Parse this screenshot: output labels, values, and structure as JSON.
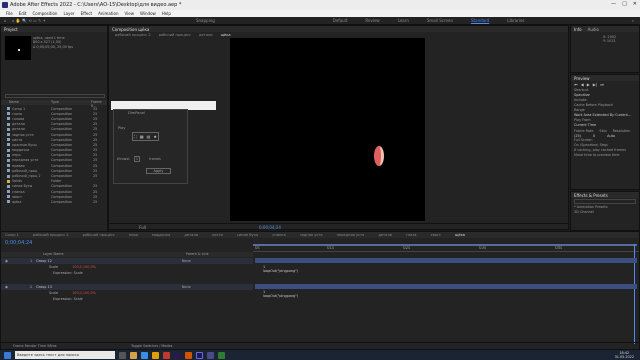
{
  "window": {
    "title": "Adobe After Effects 2022 - C:\\Users\\АО-15\\Desktop\\для видео.aep *"
  },
  "menu": [
    "File",
    "Edit",
    "Composition",
    "Layer",
    "Effect",
    "Animation",
    "View",
    "Window",
    "Help"
  ],
  "toolbar": {
    "snapping": "Snapping",
    "workspaces": [
      "Default",
      "Review",
      "Learn",
      "Small Screen",
      "Standard",
      "Libraries"
    ],
    "active_ws": "Standard"
  },
  "project": {
    "title": "Project",
    "name": "щёка",
    "used": "used 1 time",
    "info1": "800 x 527 (1,00)",
    "info2": "Δ 0;00;05;00, 25,00 fps",
    "items": [
      {
        "n": "Comp 1",
        "t": "Composition",
        "s": "25"
      },
      {
        "n": "глаза",
        "t": "Composition",
        "s": "25"
      },
      {
        "n": "голова",
        "t": "Composition",
        "s": "25"
      },
      {
        "n": "детали",
        "t": "Composition",
        "s": "25"
      },
      {
        "n": "детали",
        "t": "Composition",
        "s": "25"
      },
      {
        "n": "задняя уста",
        "t": "Composition",
        "s": "25"
      },
      {
        "n": "кисти",
        "t": "Composition",
        "s": "25"
      },
      {
        "n": "красные бусы",
        "t": "Composition",
        "s": "25"
      },
      {
        "n": "мордочка",
        "t": "Composition",
        "s": "25"
      },
      {
        "n": "перо",
        "t": "Composition",
        "s": "25"
      },
      {
        "n": "передняя уста",
        "t": "Composition",
        "s": "25"
      },
      {
        "n": "правая",
        "t": "Composition",
        "s": "25"
      },
      {
        "n": "рабочий_проц",
        "t": "Composition",
        "s": "25"
      },
      {
        "n": "рабочий_проц 2",
        "t": "Composition",
        "s": "25"
      },
      {
        "n": "Solids",
        "t": "Folder",
        "s": ""
      },
      {
        "n": "синие бусы",
        "t": "Composition",
        "s": "25"
      },
      {
        "n": "спинка",
        "t": "Composition",
        "s": "25"
      },
      {
        "n": "хвост",
        "t": "Composition",
        "s": "25"
      },
      {
        "n": "щёка",
        "t": "Composition",
        "s": "25"
      }
    ]
  },
  "comp": {
    "title": "Composition щёка",
    "breadcrumbs": [
      "рабочий процесс 2",
      "рабочий процесс",
      "детали",
      "щёка"
    ],
    "zoom": "Full",
    "timecode": "0;00;04;24"
  },
  "dialog": {
    "title": "DimPanel",
    "label": "Play",
    "field_label": "Итоwsl:",
    "value": "1",
    "unit": "frames",
    "apply": "Apply"
  },
  "info": {
    "tabs": [
      "Info",
      "Audio"
    ],
    "x": "X: 2052",
    "y": "Y: 1013"
  },
  "preview": {
    "title": "Preview",
    "shortcut_label": "Shortcut",
    "shortcut": "Spacebar",
    "include": "Include:",
    "cache": "Cache Before Playback",
    "range_label": "Range",
    "range": "Work Area Extended By Current...",
    "play_from_label": "Play From",
    "play_from": "Current Time",
    "fr_head": [
      "Frame Rate",
      "Skip",
      "Resolution"
    ],
    "fps": "(25)",
    "skip": "0",
    "res": "Auto",
    "fullscreen": "Full Screen",
    "on_stop": "On (Spacebar) Stop:",
    "cache_opt": "If caching, play cached frames",
    "move_time": "Move time to preview time"
  },
  "effects": {
    "title": "Effects & Presets",
    "item1": "* Animation Presets",
    "item2": "3D Channel"
  },
  "timeline": {
    "tabs": [
      "Comp 1",
      "рабочий процесс 2",
      "рабочий процесс",
      "перо",
      "мордочка",
      "детали",
      "кисти",
      "синие бусы",
      "спинка",
      "задняя уста",
      "передняя уста",
      "детали",
      "глаза",
      "хвост",
      "щёка"
    ],
    "timecode": "0;00;04;24",
    "ruler": [
      "0s",
      "01s",
      "02s",
      "03s",
      "04s"
    ],
    "col_head": "Layer Name",
    "parent_head": "Parent & Link",
    "layers": [
      {
        "num": "1",
        "name": "Group 12",
        "parent": "None",
        "prop": "Scale",
        "val": "100,0,100,0%",
        "expr": "Expression: Scale",
        "code": "loopOut(\"pingpong\")"
      },
      {
        "num": "2",
        "name": "Group 13",
        "parent": "None",
        "prop": "Scale",
        "val": "100,0,100,0%",
        "expr": "Expression: Scale",
        "code": "loopOut(\"pingpong\")"
      }
    ],
    "footer_left": "Frame Render Time 98ms",
    "footer_mid": "Toggle Switches / Modes"
  },
  "taskbar": {
    "search": "Введите здесь текст для поиска",
    "time": "18:42",
    "date": "31.05.2022"
  }
}
